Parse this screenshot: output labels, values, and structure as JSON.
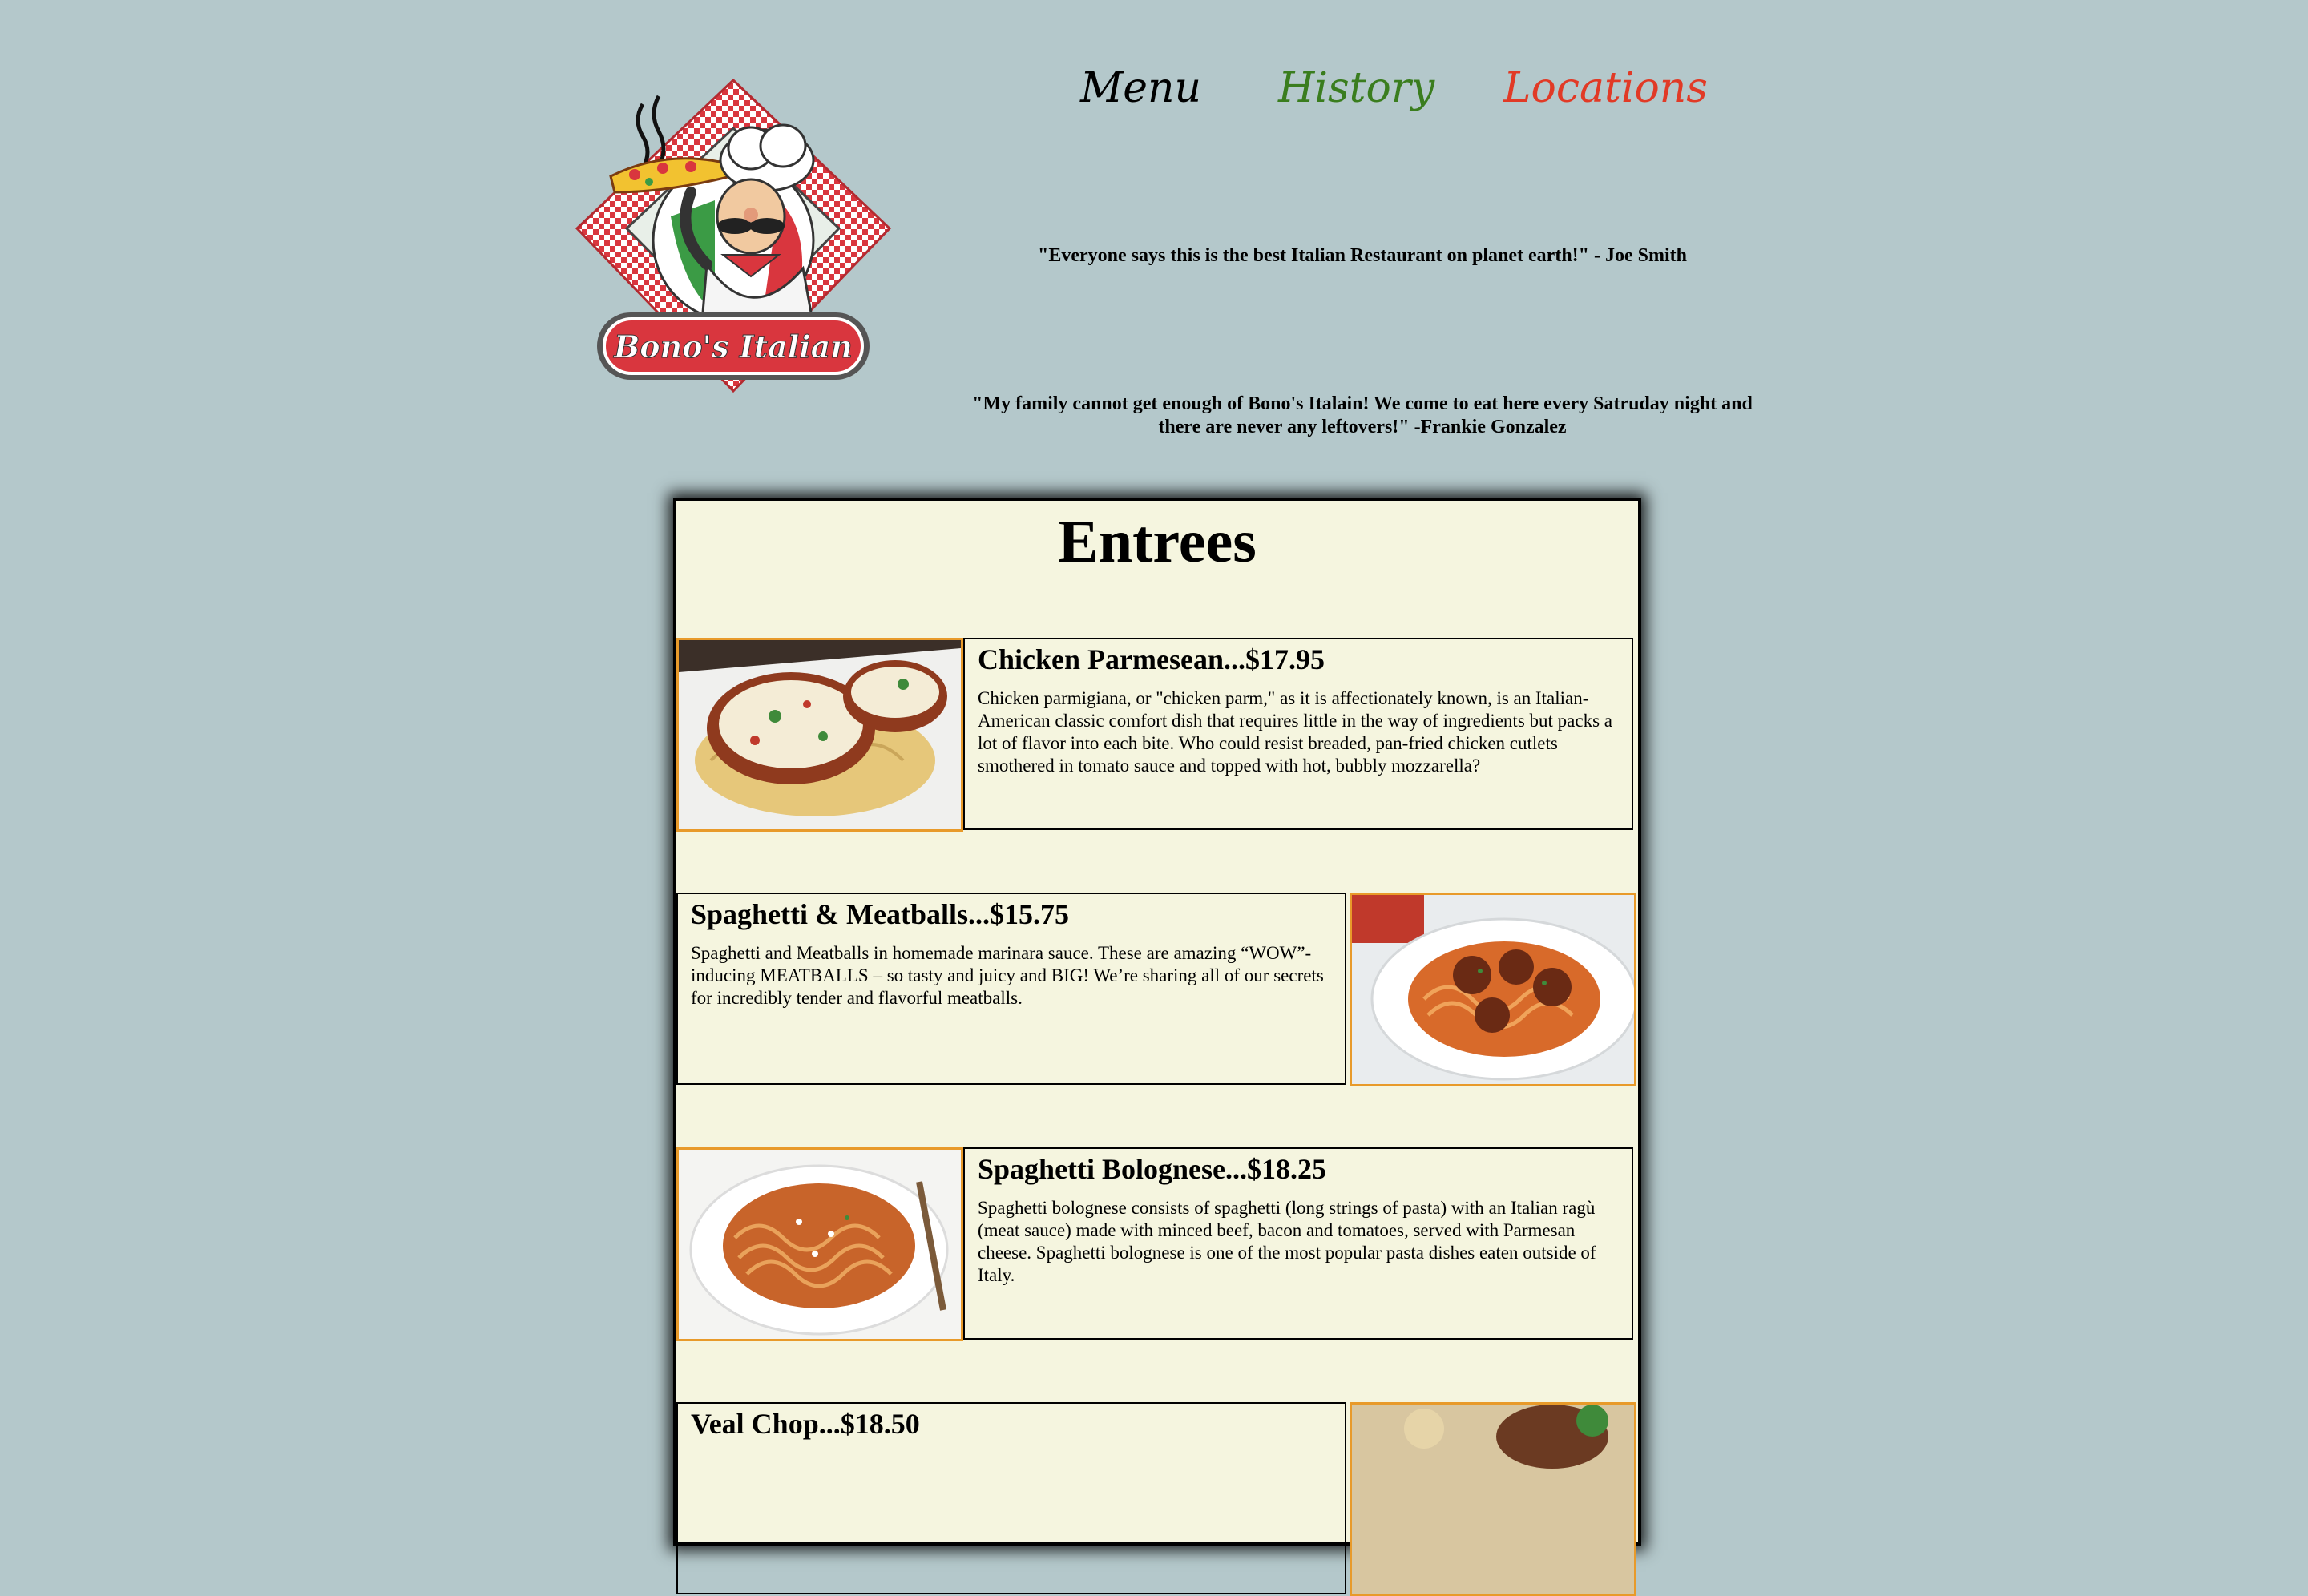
{
  "nav": {
    "menu": "Menu",
    "history": "History",
    "locations": "Locations"
  },
  "logo": {
    "text": "Bono's Italian"
  },
  "quotes": [
    "\"Everyone says this is the best Italian Restaurant on planet earth!\" - Joe Smith",
    "\"My family cannot get enough of Bono's Italain! We come to eat here every Satruday night and there are never any leftovers!\" -Frankie Gonzalez"
  ],
  "menu_section": {
    "title": "Entrees",
    "items": [
      {
        "title": "Chicken Parmesean...$17.95",
        "description": "Chicken parmigiana, or \"chicken parm,\" as it is affectionately known, is an Italian-American classic comfort dish that requires little in the way of ingredients but packs a lot of flavor into each bite. Who could resist breaded, pan-fried chicken cutlets smothered in tomato sauce and topped with hot, bubbly mozzarella?"
      },
      {
        "title": "Spaghetti & Meatballs...$15.75",
        "description": "Spaghetti and Meatballs in homemade marinara sauce. These are amazing “WOW”-inducing MEATBALLS – so tasty and juicy and BIG! We’re sharing all of our secrets for incredibly tender and flavorful meatballs."
      },
      {
        "title": "Spaghetti Bolognese...$18.25",
        "description": "Spaghetti bolognese consists of spaghetti (long strings of pasta) with an Italian ragù (meat sauce) made with minced beef, bacon and tomatoes, served with Parmesan cheese. Spaghetti bolognese is one of the most popular pasta dishes eaten outside of Italy."
      },
      {
        "title": "Veal Chop...$18.50",
        "description": ""
      }
    ]
  },
  "colors": {
    "background": "#b4c8cb",
    "panel": "#f5f5df",
    "history_link": "#3a7d1e",
    "locations_link": "#e13a26",
    "photo_border": "#e89a2a"
  }
}
